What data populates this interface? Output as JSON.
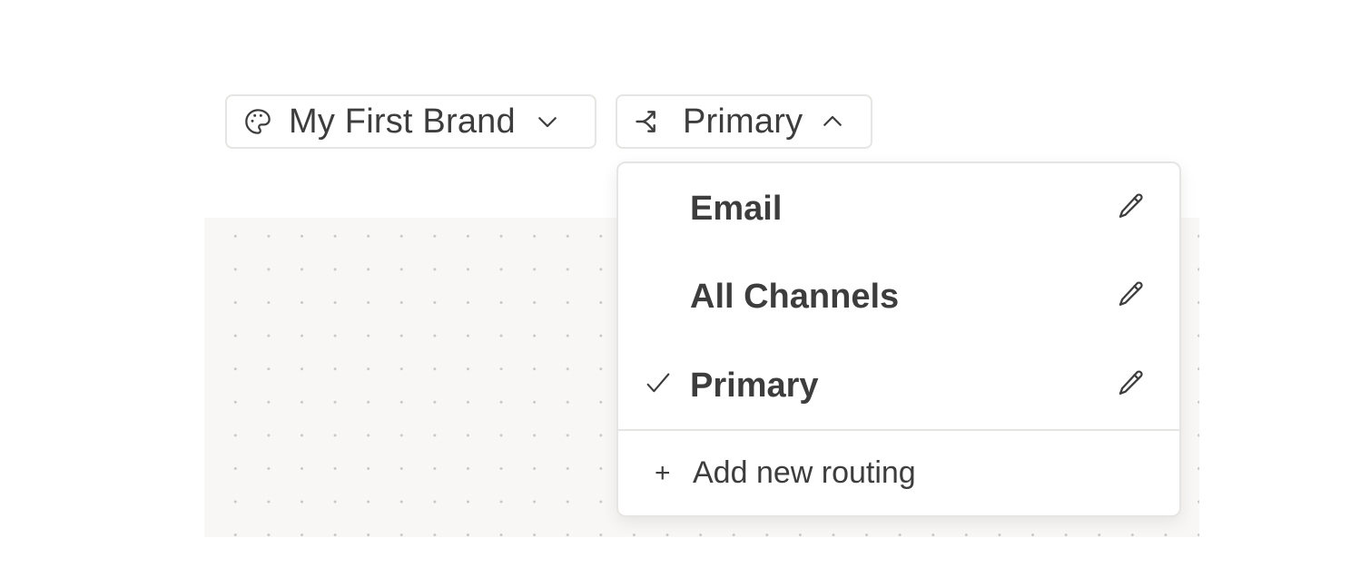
{
  "brand_selector": {
    "label": "My First Brand",
    "icon": "palette-icon",
    "chevron": "chevron-down-icon"
  },
  "routing_selector": {
    "label": "Primary",
    "icon": "routing-icon",
    "chevron": "chevron-up-icon",
    "expanded": true
  },
  "routing_menu": {
    "items": [
      {
        "label": "Email",
        "selected": false,
        "edit_icon": "pencil-icon"
      },
      {
        "label": "All Channels",
        "selected": false,
        "edit_icon": "pencil-icon"
      },
      {
        "label": "Primary",
        "selected": true,
        "edit_icon": "pencil-icon"
      }
    ],
    "add": {
      "symbol": "+",
      "label": "Add new routing"
    }
  },
  "colors": {
    "text": "#3d3d3d",
    "border": "#e6e5e3",
    "canvas_bg": "#f8f7f6",
    "canvas_dots": "#c9c6c3"
  }
}
